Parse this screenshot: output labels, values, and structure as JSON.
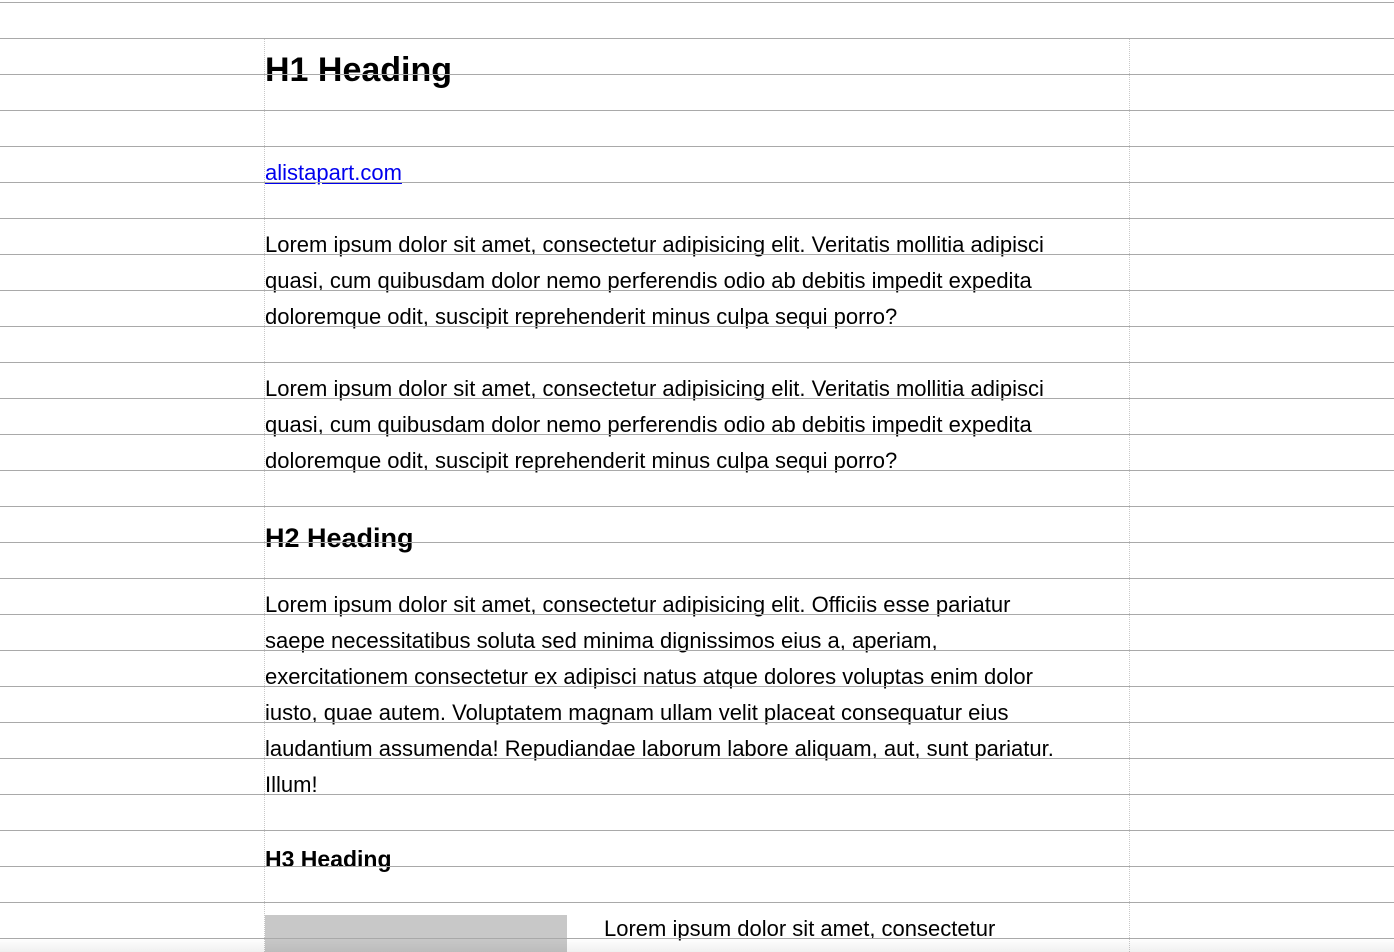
{
  "h1": "H1 Heading",
  "link": "alistapart.com",
  "paragraphs": [
    {
      "lines": [
        "Lorem ipsum dolor sit amet, consectetur adipisicing elit. Veritatis mollitia adipisci",
        "quasi, cum quibusdam dolor nemo perferendis odio ab debitis impedit expedita",
        "doloremque odit, suscipit reprehenderit minus culpa sequi porro?"
      ]
    },
    {
      "lines": [
        "Lorem ipsum dolor sit amet, consectetur adipisicing elit. Veritatis mollitia adipisci",
        "quasi, cum quibusdam dolor nemo perferendis odio ab debitis impedit expedita",
        "doloremque odit, suscipit reprehenderit minus culpa sequi porro?"
      ]
    },
    {
      "lines": [
        "Lorem ipsum dolor sit amet, consectetur adipisicing elit. Officiis esse pariatur",
        "saepe necessitatibus soluta sed minima dignissimos eius a, aperiam,",
        "exercitationem consectetur ex adipisci natus atque dolores voluptas enim dolor",
        "iusto, quae autem. Voluptatem magnam ullam velit placeat consequatur eius",
        "laudantium assumenda! Repudiandae laborum labore aliquam, aut, sunt pariatur.",
        "Illum!"
      ]
    }
  ],
  "h2": "H2 Heading",
  "h3": "H3 Heading",
  "figure_caption_text": "Lorem ipsum dolor sit amet, consectetur",
  "colors": {
    "link": "#0000ee",
    "grid_line": "#a9a9a9",
    "figure_placeholder": "#c8c8c8",
    "text": "#000000"
  }
}
